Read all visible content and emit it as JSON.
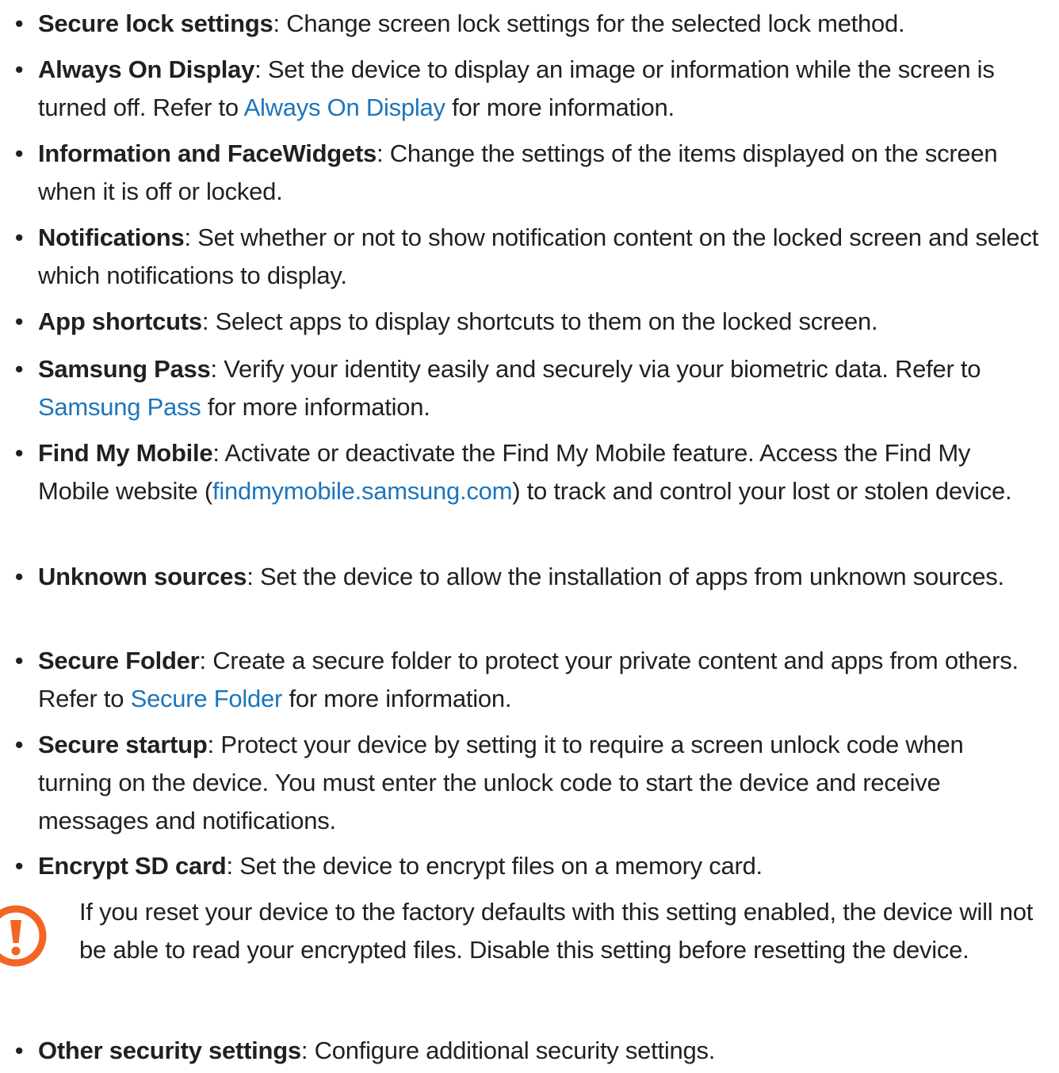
{
  "items": [
    {
      "bullet": "•",
      "term": "Secure lock settings",
      "sep": ":",
      "text": " Change screen lock settings for the selected lock method."
    },
    {
      "bullet": "•",
      "term": "Always On Display",
      "sep": ":",
      "text_before": " Set the device to display an image or information while the screen is turned off. Refer to ",
      "link": "Always On Display",
      "text_after": " for more information."
    },
    {
      "bullet": "•",
      "term": "Information and FaceWidgets",
      "sep": ":",
      "text": " Change the settings of the items displayed on the screen when it is off or locked."
    },
    {
      "bullet": "•",
      "term": "Notifications",
      "sep": ":",
      "text": " Set whether or not to show notification content on the locked screen and select which notifications to display."
    },
    {
      "bullet": "•",
      "term": "App shortcuts",
      "sep": ":",
      "text": " Select apps to display shortcuts to them on the locked screen."
    },
    {
      "bullet": "•",
      "term": "Samsung Pass",
      "sep": ":",
      "text_before": " Verify your identity easily and securely via your biometric data. Refer to ",
      "link": "Samsung Pass",
      "text_after": " for more information."
    },
    {
      "bullet": "•",
      "term": "Find My Mobile",
      "sep": ":",
      "text_before": " Activate or deactivate the Find My Mobile feature. Access the Find My Mobile website (",
      "link": "findmymobile.samsung.com",
      "text_after": ") to track and control your lost or stolen device."
    },
    {
      "bullet": "•",
      "term": "Unknown sources",
      "sep": ":",
      "text": " Set the device to allow the installation of apps from unknown sources."
    },
    {
      "bullet": "•",
      "term": "Secure Folder",
      "sep": ":",
      "text_before": " Create a secure folder to protect your private content and apps from others. Refer to ",
      "link": "Secure Folder",
      "text_after": " for more information."
    },
    {
      "bullet": "•",
      "term": "Secure startup",
      "sep": ":",
      "text": " Protect your device by setting it to require a screen unlock code when turning on the device. You must enter the unlock code to start the device and receive messages and notifications."
    },
    {
      "bullet": "•",
      "term": "Encrypt SD card",
      "sep": ":",
      "text": " Set the device to encrypt files on a memory card."
    },
    {
      "bullet": "•",
      "term": "Other security settings",
      "sep": ":",
      "text": " Configure additional security settings."
    }
  ],
  "caution": {
    "icon": "caution-icon",
    "text": "If you reset your device to the factory defaults with this setting enabled, the device will not be able to read your encrypted files. Disable this setting before resetting the device."
  },
  "colors": {
    "text": "#231f20",
    "link": "#1c75bc",
    "caution": "#f26522"
  }
}
